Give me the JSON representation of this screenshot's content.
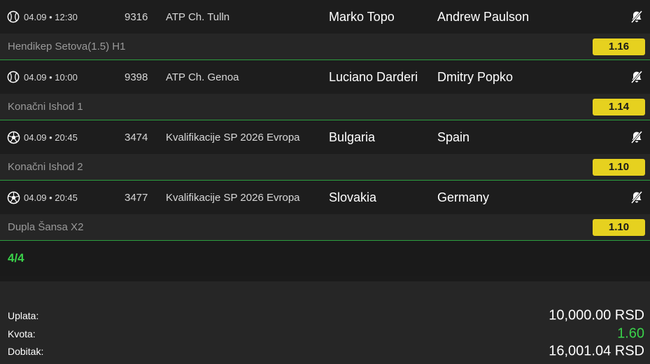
{
  "matches": [
    {
      "sport_icon": "tennis-ball-icon",
      "time": "04.09 • 12:30",
      "code": "9316",
      "league": "ATP Ch. Tulln",
      "home": "Marko Topo",
      "away": "Andrew Paulson",
      "market": "Hendikep Setova(1.5) H1",
      "odd": "1.16"
    },
    {
      "sport_icon": "tennis-ball-icon",
      "time": "04.09 • 10:00",
      "code": "9398",
      "league": "ATP Ch. Genoa",
      "home": "Luciano Darderi",
      "away": "Dmitry Popko",
      "market": "Konačni Ishod 1",
      "odd": "1.14"
    },
    {
      "sport_icon": "soccer-ball-icon",
      "time": "04.09 • 20:45",
      "code": "3474",
      "league": "Kvalifikacije SP 2026 Evropa",
      "home": "Bulgaria",
      "away": "Spain",
      "market": "Konačni Ishod 2",
      "odd": "1.10"
    },
    {
      "sport_icon": "soccer-ball-icon",
      "time": "04.09 • 20:45",
      "code": "3477",
      "league": "Kvalifikacije SP 2026 Evropa",
      "home": "Slovakia",
      "away": "Germany",
      "market": "Dupla Šansa X2",
      "odd": "1.10"
    }
  ],
  "count": "4/4",
  "summary": {
    "stake_label": "Uplata:",
    "stake_value": "10,000.00 RSD",
    "odds_label": "Kvota:",
    "odds_value": "1.60",
    "win_label": "Dobitak:",
    "win_value": "16,001.04 RSD"
  },
  "colors": {
    "accent_green": "#3ad14a",
    "odd_yellow": "#e6d11f",
    "row_dark": "#1d1d1d",
    "row_market": "#262626"
  }
}
